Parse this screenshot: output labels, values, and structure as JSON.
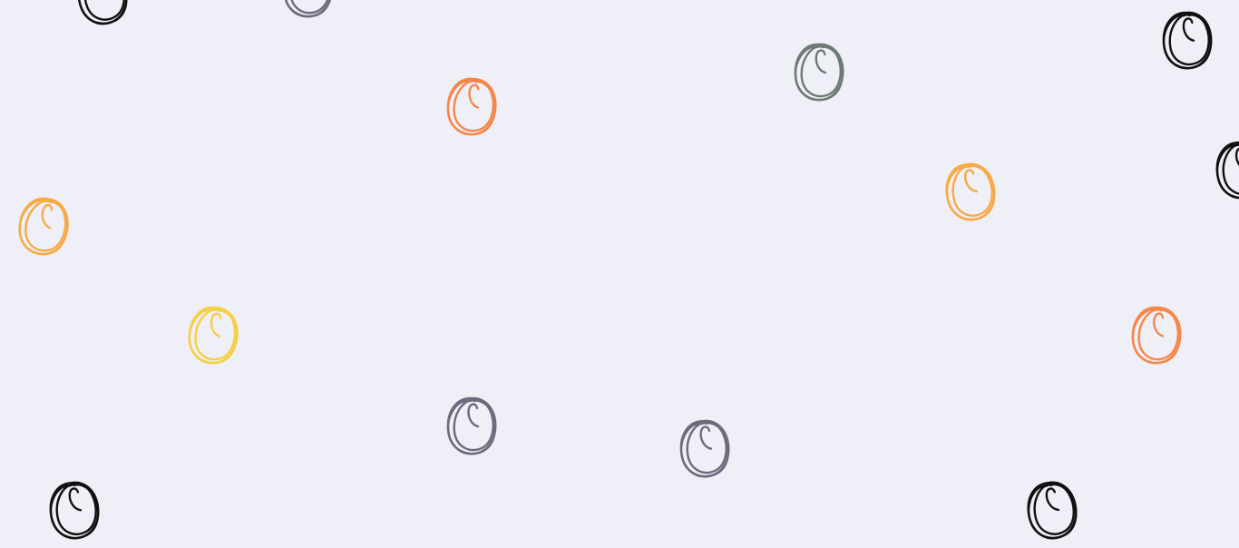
{
  "background_color": "#eff0f7",
  "palette": {
    "black": "#111111",
    "slate": "#6c6b7d",
    "orange": "#f5874b",
    "sage": "#6d7a74",
    "amber": "#f6aa48",
    "yellow": "#f7cf45"
  },
  "decorations": [
    {
      "icon": "scribble-circle-icon",
      "color": "black"
    },
    {
      "icon": "scribble-circle-icon",
      "color": "slate"
    },
    {
      "icon": "scribble-circle-icon",
      "color": "orange"
    },
    {
      "icon": "scribble-circle-icon",
      "color": "sage"
    },
    {
      "icon": "scribble-circle-icon",
      "color": "black"
    },
    {
      "icon": "scribble-circle-icon",
      "color": "black"
    },
    {
      "icon": "scribble-circle-icon",
      "color": "amber"
    },
    {
      "icon": "scribble-circle-icon",
      "color": "amber"
    },
    {
      "icon": "scribble-circle-icon",
      "color": "yellow"
    },
    {
      "icon": "scribble-circle-icon",
      "color": "orange"
    },
    {
      "icon": "scribble-circle-icon",
      "color": "slate"
    },
    {
      "icon": "scribble-circle-icon",
      "color": "slate"
    },
    {
      "icon": "scribble-circle-icon",
      "color": "black"
    },
    {
      "icon": "scribble-circle-icon",
      "color": "black"
    }
  ]
}
